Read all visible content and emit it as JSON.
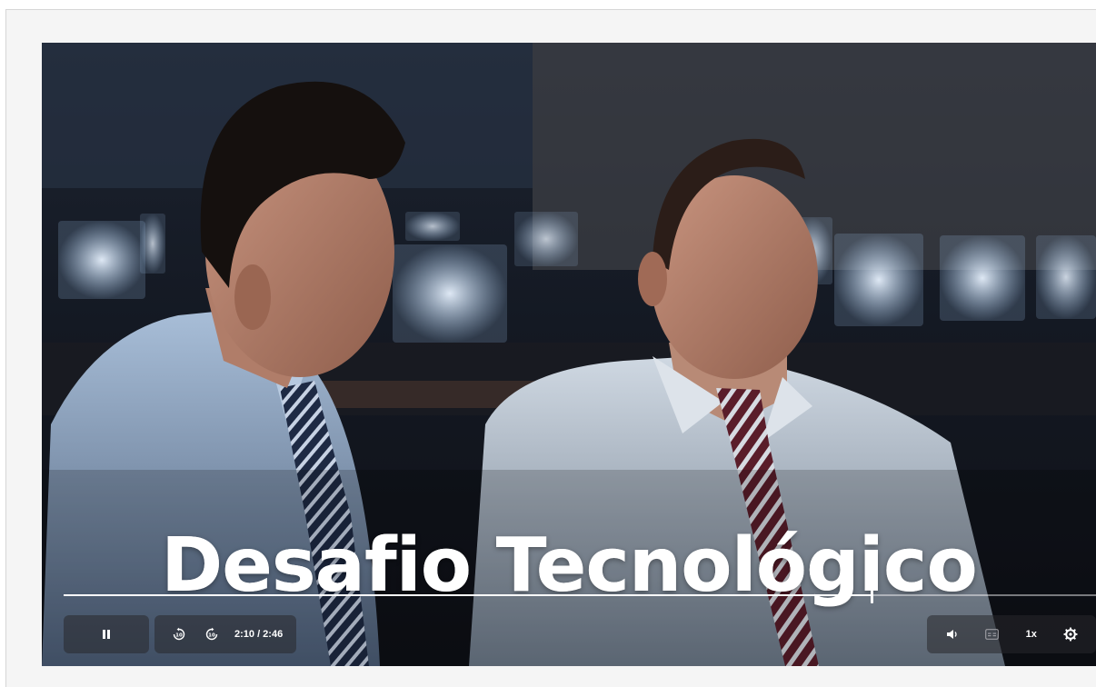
{
  "video": {
    "caption": "Desafio Tecnológico"
  },
  "progress": {
    "current": "2:10",
    "duration": "2:46",
    "fraction": 0.783
  },
  "controls": {
    "time_display": "2:10 / 2:46",
    "rewind_label": "10",
    "forward_label": "10",
    "speed_label": "1x"
  },
  "icons": {
    "play_state": "pause-icon",
    "rewind": "rewind-10-icon",
    "forward": "forward-10-icon",
    "volume": "volume-icon",
    "captions": "captions-icon",
    "settings": "gear-icon"
  },
  "colors": {
    "accent": "#ffffff",
    "controls_bg": "#28282c"
  }
}
